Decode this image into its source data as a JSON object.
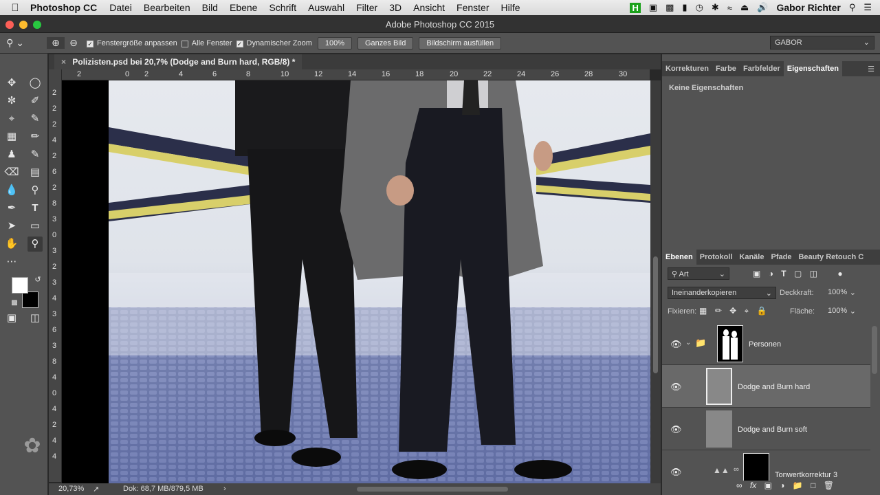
{
  "menubar": {
    "app": "Photoshop CC",
    "items": [
      "Datei",
      "Bearbeiten",
      "Bild",
      "Ebene",
      "Schrift",
      "Auswahl",
      "Filter",
      "3D",
      "Ansicht",
      "Fenster",
      "Hilfe"
    ],
    "user": "Gabor Richter"
  },
  "window": {
    "title": "Adobe Photoshop CC 2015"
  },
  "options": {
    "fit_window_label": "Fenstergröße anpassen",
    "all_windows_label": "Alle Fenster",
    "dynamic_zoom_label": "Dynamischer Zoom",
    "zoom_value": "100%",
    "whole_image_button": "Ganzes Bild",
    "fill_screen_button": "Bildschirm ausfüllen",
    "workspace": "GABOR"
  },
  "document": {
    "tab_title": "Polizisten.psd bei 20,7% (Dodge and Burn hard, RGB/8) *",
    "ruler_h": [
      "2",
      "0",
      "2",
      "4",
      "6",
      "8",
      "10",
      "12",
      "14",
      "16",
      "18",
      "20",
      "22",
      "24",
      "26",
      "28",
      "30"
    ],
    "ruler_v": [
      "2",
      "2",
      "2",
      "4",
      "2",
      "6",
      "2",
      "8",
      "3",
      "0",
      "3",
      "2",
      "3",
      "4",
      "3",
      "6",
      "3",
      "8",
      "4",
      "0",
      "4",
      "2",
      "4",
      "4"
    ],
    "status_zoom": "20,73%",
    "status_doc": "Dok: 68,7 MB/879,5 MB"
  },
  "properties_panel": {
    "tabs": [
      "Korrekturen",
      "Farbe",
      "Farbfelder",
      "Eigenschaften"
    ],
    "active_tab": "Eigenschaften",
    "empty_text": "Keine Eigenschaften"
  },
  "layers_panel": {
    "tabs": [
      "Ebenen",
      "Protokoll",
      "Kanäle",
      "Pfade",
      "Beauty Retouch C"
    ],
    "filter_kind": "Art",
    "blend_mode": "Ineinanderkopieren",
    "opacity_label": "Deckkraft:",
    "opacity_value": "100%",
    "lock_label": "Fixieren:",
    "fill_label": "Fläche:",
    "fill_value": "100%",
    "layers": [
      {
        "name": "Personen",
        "type": "group"
      },
      {
        "name": "Dodge and Burn hard",
        "type": "pixel",
        "selected": true
      },
      {
        "name": "Dodge and Burn soft",
        "type": "pixel"
      },
      {
        "name": "Tonwertkorrektur 3",
        "type": "adjustment"
      }
    ]
  },
  "colors": {
    "foreground": "#ffffff",
    "background": "#000000",
    "panel": "#535353",
    "selected_layer": "#696969"
  }
}
